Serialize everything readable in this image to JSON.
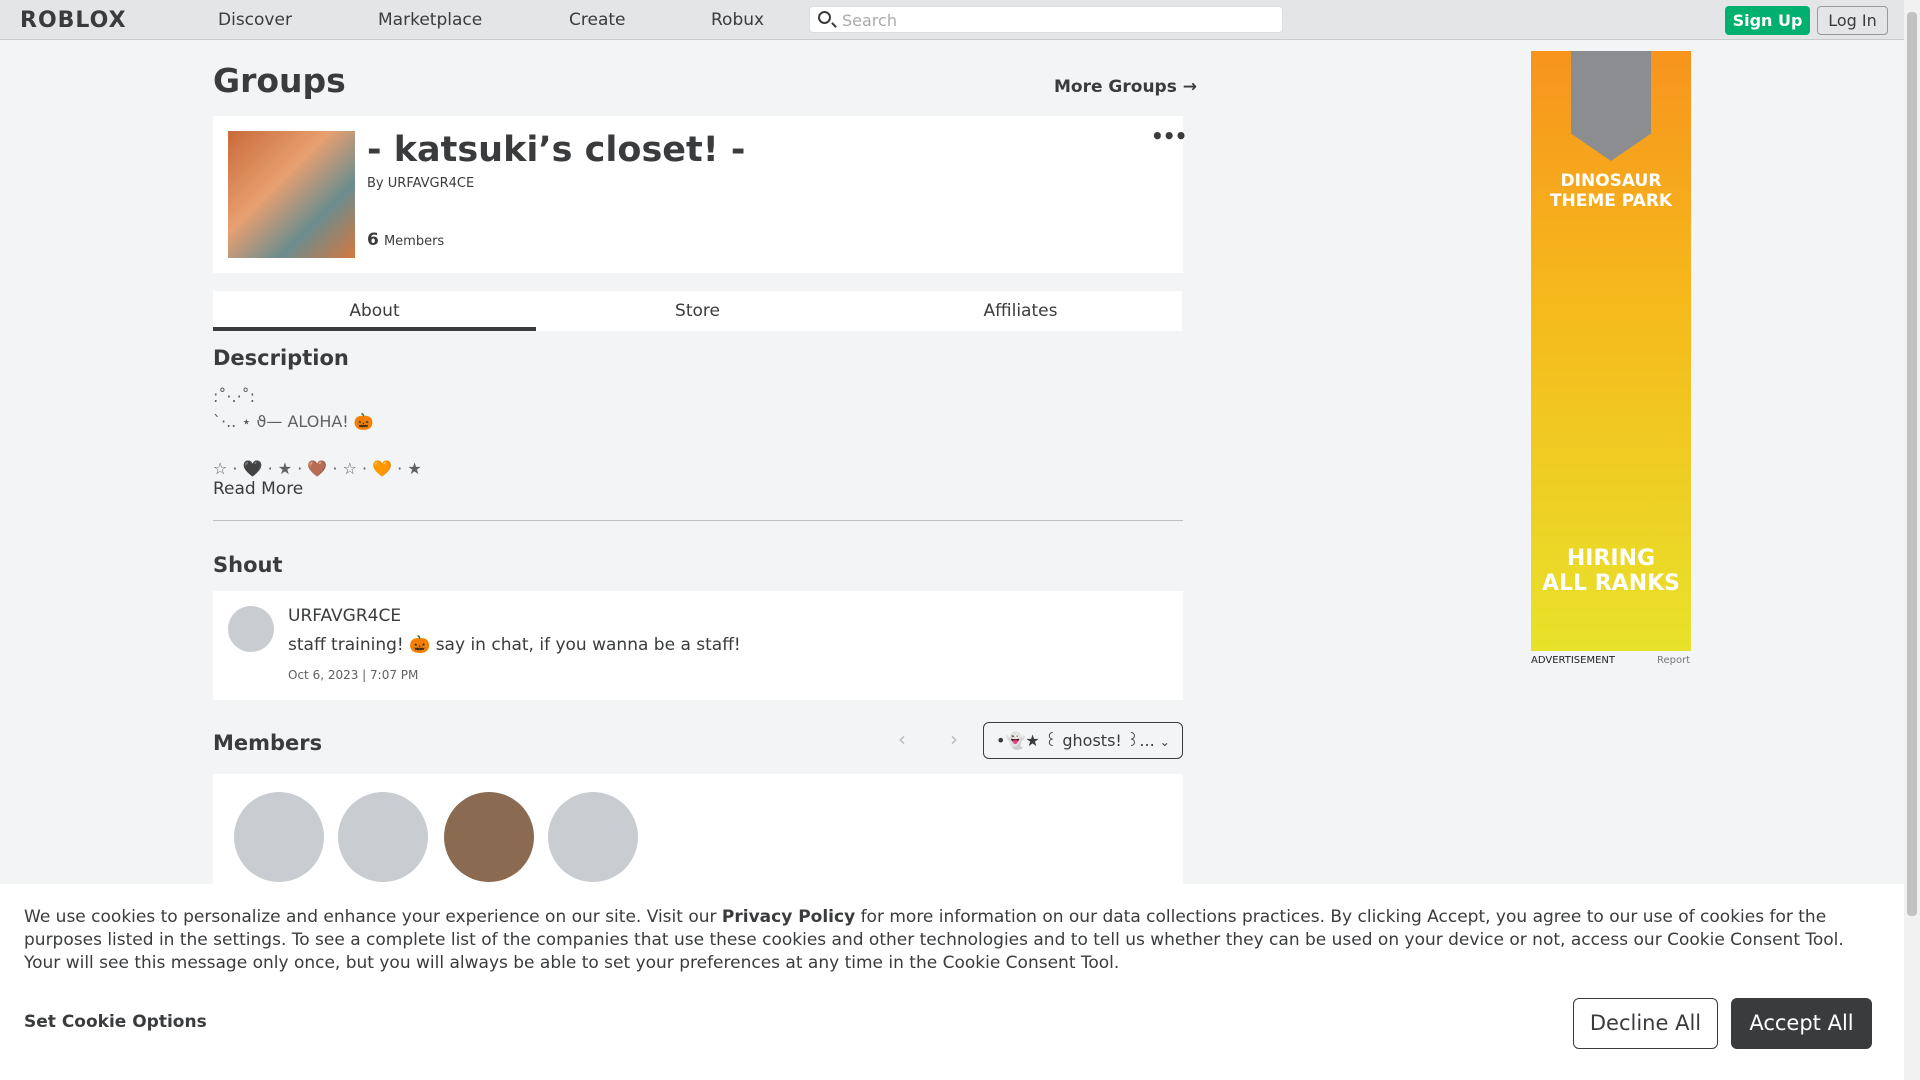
{
  "nav": {
    "logo": "ROBLOX",
    "links": [
      "Discover",
      "Marketplace",
      "Create",
      "Robux"
    ],
    "search_placeholder": "Search",
    "signup": "Sign Up",
    "login": "Log In"
  },
  "page": {
    "title": "Groups",
    "more_groups": "More Groups →"
  },
  "group": {
    "name": "- katsuki’s closet! -",
    "by_label": "By",
    "owner": "URFAVGR4CE",
    "member_count": "6",
    "members_label": "Members",
    "more_icon": "ellipsis-icon"
  },
  "tabs": [
    {
      "label": "About",
      "active": true
    },
    {
      "label": "Store"
    },
    {
      "label": "Affiliates"
    }
  ],
  "description": {
    "heading": "Description",
    "lines": [
      ":˚·.·˚:",
      "`·.. ⋆ ϑ— ALOHA! 🎃",
      "☆ · 🖤 · ★ · 🤎 · ☆ · 🧡 · ★"
    ],
    "read_more": "Read More"
  },
  "shout": {
    "heading": "Shout",
    "author": "URFAVGR4CE",
    "message": "staff training! 🎃 say in chat, if you wanna be a staff!",
    "date": "Oct 6, 2023 | 7:07 PM"
  },
  "members": {
    "heading": "Members",
    "role_select": "•👻★ ꒰ ghosts! ꒱...",
    "count_shown": 4
  },
  "ad": {
    "label": "ADVERTISEMENT",
    "report": "Report",
    "text1": "DINOSAUR THEME PARK",
    "text2": "HIRING ALL RANKS",
    "colors": {
      "top": "#f7941d",
      "bottom": "#e8e22a"
    }
  },
  "cookie": {
    "text_pre": "We use cookies to personalize and enhance your experience on our site. Visit our ",
    "privacy_link": "Privacy Policy",
    "text_post": " for more information on our data collections practices. By clicking Accept, you agree to our use of cookies for the purposes listed in the settings. To see a complete list of the companies that use these cookies and other technologies and to tell us whether they can be used on your device or not, access our Cookie Consent Tool. Your will see this message only once, but you will always be able to set your preferences at any time in the Cookie Consent Tool.",
    "set_options": "Set Cookie Options",
    "decline": "Decline All",
    "accept": "Accept All"
  },
  "colors": {
    "accent_green": "#00b06f",
    "dark_button": "#393b3d"
  }
}
